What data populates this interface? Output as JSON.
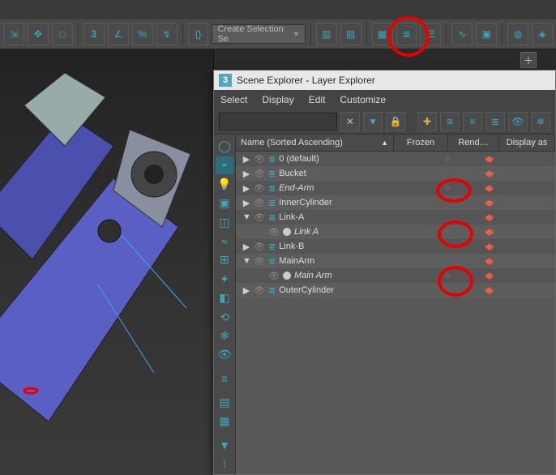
{
  "toolbar": {
    "selection_set_label": "Create Selection Se"
  },
  "panel": {
    "title": "Scene Explorer - Layer Explorer",
    "menus": [
      "Select",
      "Display",
      "Edit",
      "Customize"
    ],
    "header": {
      "name": "Name (Sorted Ascending)",
      "sort_indicator": "▲",
      "frozen": "Frozen",
      "renderable": "Rend…",
      "display_as": "Display as"
    },
    "rows": [
      {
        "indent": 0,
        "expand": "▶",
        "kind": "layer",
        "label": "0 (default)",
        "italic": false,
        "frozen": true,
        "rend": true
      },
      {
        "indent": 0,
        "expand": "▶",
        "kind": "layer",
        "label": "Bucket",
        "italic": false,
        "frozen": false,
        "rend": true
      },
      {
        "indent": 0,
        "expand": "▶",
        "kind": "layer",
        "label": "End-Arm",
        "italic": true,
        "frozen": true,
        "rend": true
      },
      {
        "indent": 0,
        "expand": "▶",
        "kind": "layer",
        "label": "InnerCylinder",
        "italic": false,
        "frozen": false,
        "rend": true
      },
      {
        "indent": 0,
        "expand": "▼",
        "kind": "layer",
        "label": "Link-A",
        "italic": false,
        "frozen": false,
        "rend": true
      },
      {
        "indent": 1,
        "expand": "",
        "kind": "object",
        "label": "Link A",
        "italic": true,
        "frozen": true,
        "rend": true
      },
      {
        "indent": 0,
        "expand": "▶",
        "kind": "layer",
        "label": "Link-B",
        "italic": false,
        "frozen": false,
        "rend": true
      },
      {
        "indent": 0,
        "expand": "▼",
        "kind": "layer",
        "label": "MainArm",
        "italic": false,
        "frozen": false,
        "rend": true
      },
      {
        "indent": 1,
        "expand": "",
        "kind": "object",
        "label": "Main Arm",
        "italic": true,
        "frozen": true,
        "rend": true
      },
      {
        "indent": 0,
        "expand": "▶",
        "kind": "layer",
        "label": "OuterCylinder",
        "italic": false,
        "frozen": false,
        "rend": true
      }
    ]
  }
}
